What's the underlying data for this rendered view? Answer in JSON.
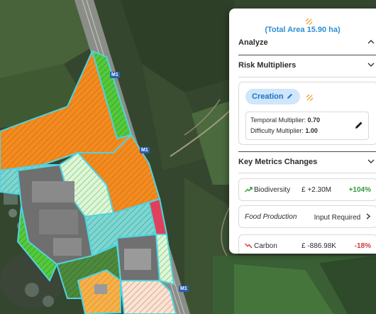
{
  "map": {
    "road_labels": [
      "M1",
      "M1",
      "M1"
    ]
  },
  "panel": {
    "total_area": "(Total Area 15.90 ha)",
    "analyze": {
      "title": "Analyze"
    },
    "risk": {
      "title": "Risk Multipliers",
      "scenario_label": "Creation",
      "temporal_label": "Temporal Multiplier:",
      "temporal_value": "0.70",
      "difficulty_label": "Difficulty Multiplier:",
      "difficulty_value": "1.00"
    },
    "metrics": {
      "title": "Key Metrics Changes",
      "rows": [
        {
          "name": "Biodiversity",
          "value": "£ +2.30M",
          "change": "+104%"
        },
        {
          "name": "Food Production",
          "action": "Input Required"
        },
        {
          "name": "Carbon",
          "value": "£ -886.98K",
          "change": "-18%"
        }
      ]
    }
  },
  "colors": {
    "accent_blue": "#2d8fd5",
    "positive": "#2f9a3b",
    "negative": "#d33a3a",
    "orange_zone": "#f28c1f",
    "green_zone": "#4fc23a"
  }
}
